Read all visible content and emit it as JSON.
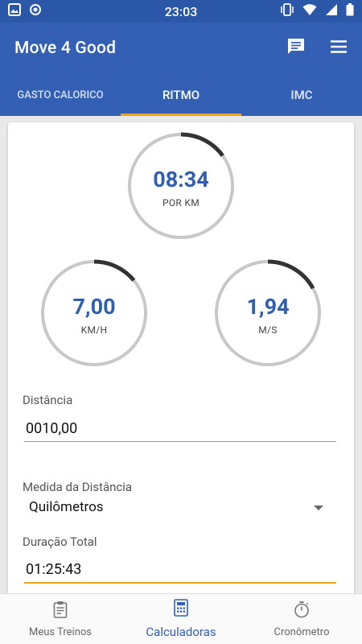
{
  "status": {
    "time": "23:03"
  },
  "app": {
    "title": "Move 4 Good"
  },
  "tabs": [
    {
      "label": "GASTO CALORICO"
    },
    {
      "label": "RITMO"
    },
    {
      "label": "IMC"
    }
  ],
  "gauges": {
    "pace": {
      "value": "08:34",
      "unit": "POR KM",
      "progress": 0.15
    },
    "kmh": {
      "value": "7,00",
      "unit": "KM/H",
      "progress": 0.14
    },
    "ms": {
      "value": "1,94",
      "unit": "M/S",
      "progress": 0.17
    }
  },
  "form": {
    "distance_label": "Distância",
    "distance_value": "0010,00",
    "measure_label": "Medida da Distância",
    "measure_value": "Quilômetros",
    "duration_label": "Duração Total",
    "duration_value": "01:25:43"
  },
  "bottom_nav": [
    {
      "label": "Meus Treinos"
    },
    {
      "label": "Calculadoras"
    },
    {
      "label": "Cronômetro"
    }
  ],
  "colors": {
    "primary": "#3360b5",
    "accent": "#f3a21b",
    "gauge_value": "#2f5fb0"
  }
}
